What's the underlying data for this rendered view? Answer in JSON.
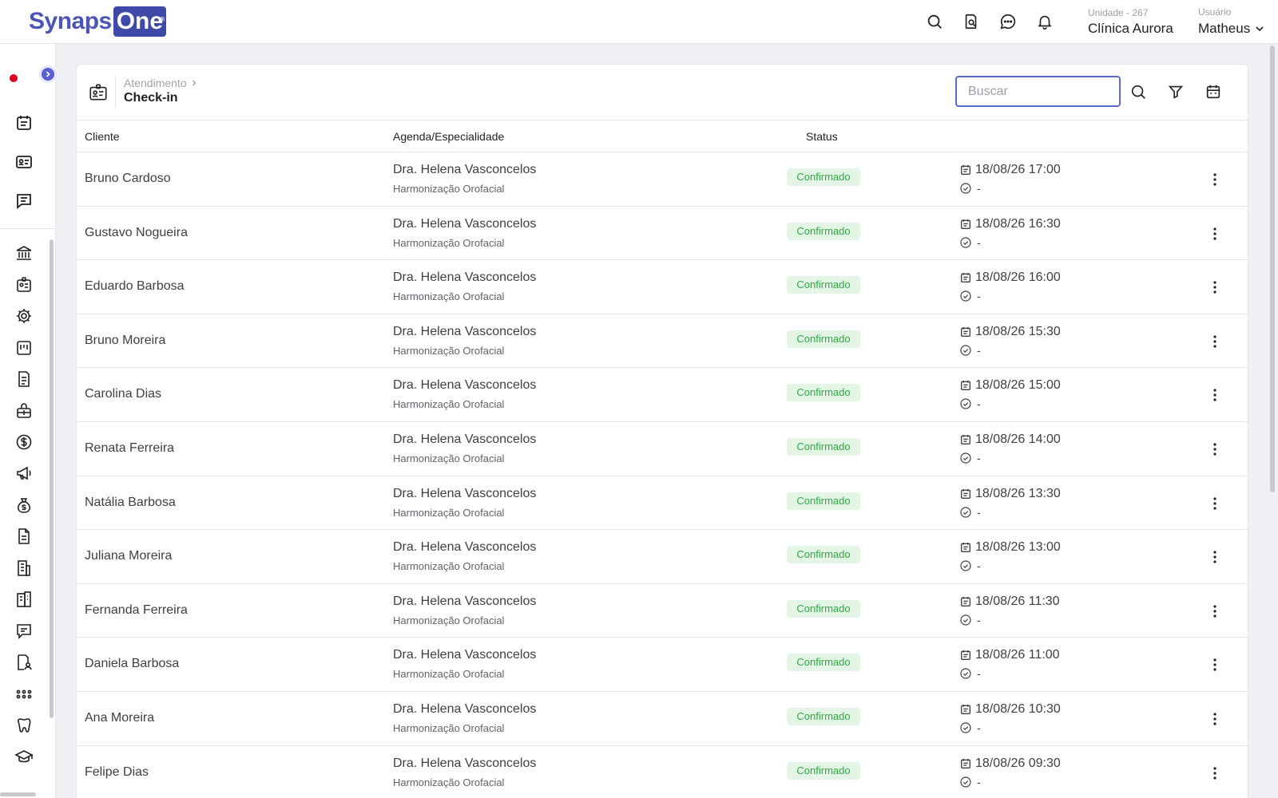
{
  "brand": {
    "logo_part1": "Synaps",
    "logo_part2": "One",
    "logo_mark": "®"
  },
  "header": {
    "unit_label": "Unidade - 267",
    "unit_name": "Clínica Aurora",
    "user_label": "Usuário",
    "user_name": "Matheus",
    "icons": [
      "search-icon",
      "document-search-icon",
      "chat-icon",
      "bell-icon",
      "chevron-down-icon"
    ]
  },
  "sidebar": {
    "top_icons": [
      "calendar-list-icon",
      "id-card-icon",
      "message-icon"
    ],
    "menu_icons": [
      "bank-icon",
      "badge-icon",
      "gear-icon",
      "clipboard-icon",
      "document-icon",
      "medical-kit-icon",
      "dollar-icon",
      "megaphone-icon",
      "money-bag-icon",
      "file-icon",
      "building-icon",
      "building-alt-icon",
      "comment-icon",
      "user-report-icon",
      "apps-icon",
      "tooth-icon",
      "graduation-cap-icon"
    ]
  },
  "page": {
    "breadcrumb": "Atendimento",
    "title": "Check-in",
    "search_placeholder": "Buscar"
  },
  "table": {
    "columns": [
      "Cliente",
      "Agenda/Especialidade",
      "Status"
    ],
    "rows": [
      {
        "client": "Bruno Cardoso",
        "doctor": "Dra. Helena Vasconcelos",
        "specialty": "Harmonização Orofacial",
        "status": "Confirmado",
        "date": "18/08/26 17:00",
        "checkin": "-"
      },
      {
        "client": "Gustavo Nogueira",
        "doctor": "Dra. Helena Vasconcelos",
        "specialty": "Harmonização Orofacial",
        "status": "Confirmado",
        "date": "18/08/26 16:30",
        "checkin": "-"
      },
      {
        "client": "Eduardo Barbosa",
        "doctor": "Dra. Helena Vasconcelos",
        "specialty": "Harmonização Orofacial",
        "status": "Confirmado",
        "date": "18/08/26 16:00",
        "checkin": "-"
      },
      {
        "client": "Bruno Moreira",
        "doctor": "Dra. Helena Vasconcelos",
        "specialty": "Harmonização Orofacial",
        "status": "Confirmado",
        "date": "18/08/26 15:30",
        "checkin": "-"
      },
      {
        "client": "Carolina Dias",
        "doctor": "Dra. Helena Vasconcelos",
        "specialty": "Harmonização Orofacial",
        "status": "Confirmado",
        "date": "18/08/26 15:00",
        "checkin": "-"
      },
      {
        "client": "Renata Ferreira",
        "doctor": "Dra. Helena Vasconcelos",
        "specialty": "Harmonização Orofacial",
        "status": "Confirmado",
        "date": "18/08/26 14:00",
        "checkin": "-"
      },
      {
        "client": "Natália Barbosa",
        "doctor": "Dra. Helena Vasconcelos",
        "specialty": "Harmonização Orofacial",
        "status": "Confirmado",
        "date": "18/08/26 13:30",
        "checkin": "-"
      },
      {
        "client": "Juliana Moreira",
        "doctor": "Dra. Helena Vasconcelos",
        "specialty": "Harmonização Orofacial",
        "status": "Confirmado",
        "date": "18/08/26 13:00",
        "checkin": "-"
      },
      {
        "client": "Fernanda Ferreira",
        "doctor": "Dra. Helena Vasconcelos",
        "specialty": "Harmonização Orofacial",
        "status": "Confirmado",
        "date": "18/08/26 11:30",
        "checkin": "-"
      },
      {
        "client": "Daniela Barbosa",
        "doctor": "Dra. Helena Vasconcelos",
        "specialty": "Harmonização Orofacial",
        "status": "Confirmado",
        "date": "18/08/26 11:00",
        "checkin": "-"
      },
      {
        "client": "Ana Moreira",
        "doctor": "Dra. Helena Vasconcelos",
        "specialty": "Harmonização Orofacial",
        "status": "Confirmado",
        "date": "18/08/26 10:30",
        "checkin": "-"
      },
      {
        "client": "Felipe Dias",
        "doctor": "Dra. Helena Vasconcelos",
        "specialty": "Harmonização Orofacial",
        "status": "Confirmado",
        "date": "18/08/26 09:30",
        "checkin": "-"
      }
    ]
  },
  "colors": {
    "accent": "#5b5fd6",
    "status_bg": "#e3f6e5",
    "status_text": "#2fa843",
    "record_dot": "#e0001b"
  }
}
